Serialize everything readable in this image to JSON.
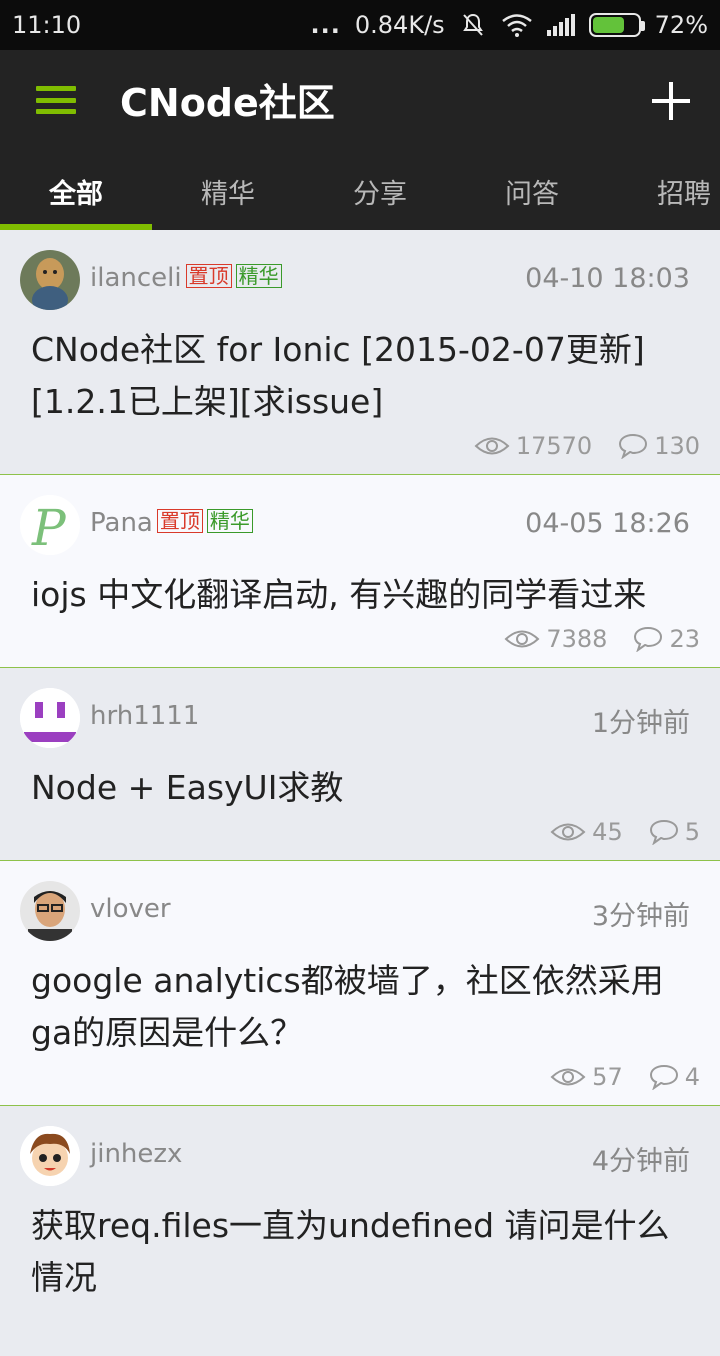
{
  "status_bar": {
    "time": "11:10",
    "dots": "...",
    "speed": "0.84K/s",
    "battery": "72%",
    "battery_level": 0.72
  },
  "app_bar": {
    "title": "CNode社区",
    "menu_icon": "hamburger-menu-icon",
    "add_icon": "plus-icon"
  },
  "tabs": [
    {
      "label": "全部",
      "active": true
    },
    {
      "label": "精华"
    },
    {
      "label": "分享"
    },
    {
      "label": "问答"
    },
    {
      "label": "招聘"
    }
  ],
  "topics": [
    {
      "author": "ilanceli",
      "badges": [
        "置顶",
        "精华"
      ],
      "time": "04-10 18:03",
      "title": "CNode社区 for Ionic [2015-02-07更新][1.2.1已上架][求issue]",
      "views": "17570",
      "replies": "130"
    },
    {
      "author": "Pana",
      "badges": [
        "置顶",
        "精华"
      ],
      "time": "04-05 18:26",
      "title": "iojs 中文化翻译启动, 有兴趣的同学看过来",
      "views": "7388",
      "replies": "23"
    },
    {
      "author": "hrh1111",
      "badges": [],
      "time": "1分钟前",
      "title": "Node + EasyUI求教",
      "views": "45",
      "replies": "5"
    },
    {
      "author": "vlover",
      "badges": [],
      "time": "3分钟前",
      "title": "google analytics都被墙了，社区依然采用ga的原因是什么？",
      "views": "57",
      "replies": "4"
    },
    {
      "author": "jinhezx",
      "badges": [],
      "time": "4分钟前",
      "title": "获取req.files一直为undefined 请问是什么情况",
      "views": "",
      "replies": ""
    }
  ],
  "colors": {
    "accent": "#80bd01",
    "toolbar": "#232323",
    "badge_top": "#d93a2b",
    "badge_good": "#3a9a2a"
  }
}
